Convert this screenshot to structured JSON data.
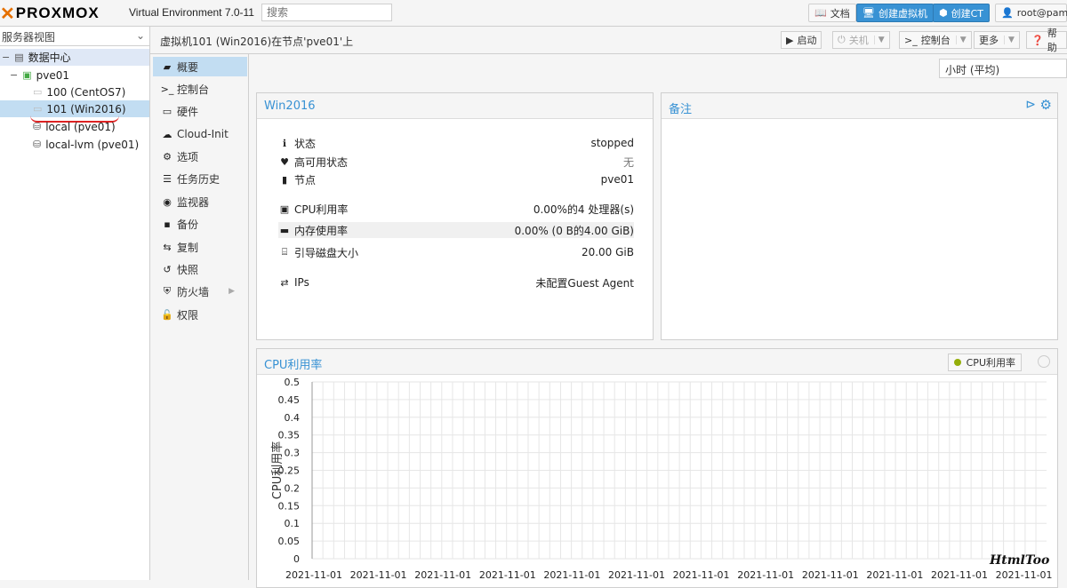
{
  "topbar": {
    "logo_text": "PROXMOX",
    "version": "Virtual Environment 7.0-11",
    "search_placeholder": "搜索",
    "docs_label": "文档",
    "create_vm_label": "创建虚拟机",
    "create_ct_label": "创建CT",
    "user_label": "root@pam"
  },
  "tree": {
    "view_label": "服务器视图",
    "datacenter": "数据中心",
    "node": "pve01",
    "vm100": "100 (CentOS7)",
    "vm101": "101 (Win2016)",
    "storage_local": "local (pve01)",
    "storage_lvm": "local-lvm (pve01)"
  },
  "header": {
    "title": "虚拟机101 (Win2016)在节点'pve01'上",
    "start": "启动",
    "shutdown": "关机",
    "console": "控制台",
    "more": "更多",
    "help": "帮助"
  },
  "nav": [
    {
      "label": "概要",
      "icon": "book-icon"
    },
    {
      "label": "控制台",
      "icon": "terminal-icon"
    },
    {
      "label": "硬件",
      "icon": "monitor-icon"
    },
    {
      "label": "Cloud-Init",
      "icon": "cloud-icon"
    },
    {
      "label": "选项",
      "icon": "gear-icon"
    },
    {
      "label": "任务历史",
      "icon": "list-icon"
    },
    {
      "label": "监视器",
      "icon": "eye-icon"
    },
    {
      "label": "备份",
      "icon": "floppy-icon"
    },
    {
      "label": "复制",
      "icon": "retweet-icon"
    },
    {
      "label": "快照",
      "icon": "history-icon"
    },
    {
      "label": "防火墙",
      "icon": "shield-icon"
    },
    {
      "label": "权限",
      "icon": "unlock-icon"
    }
  ],
  "timeframe": "小时 (平均)",
  "status_panel": {
    "title": "Win2016",
    "status_label": "状态",
    "status_value": "stopped",
    "ha_label": "高可用状态",
    "ha_value": "无",
    "node_label": "节点",
    "node_value": "pve01",
    "cpu_label": "CPU利用率",
    "cpu_value": "0.00%的4 处理器(s)",
    "mem_label": "内存使用率",
    "mem_value": "0.00% (0 B的4.00 GiB)",
    "disk_label": "引导磁盘大小",
    "disk_value": "20.00 GiB",
    "ips_label": "IPs",
    "ips_value": "未配置Guest Agent"
  },
  "notes_panel": {
    "title": "备注"
  },
  "cpu_panel": {
    "title": "CPU利用率",
    "legend": "CPU利用率"
  },
  "chart_data": {
    "type": "line",
    "ylabel": "CPU利用率",
    "ylim": [
      0,
      0.5
    ],
    "yticks": [
      "0.5",
      "0.45",
      "0.4",
      "0.35",
      "0.3",
      "0.25",
      "0.2",
      "0.15",
      "0.1",
      "0.05",
      "0"
    ],
    "xticks": [
      "2021-11-01",
      "2021-11-01",
      "2021-11-01",
      "2021-11-01",
      "2021-11-01",
      "2021-11-01",
      "2021-11-01",
      "2021-11-01",
      "2021-11-01",
      "2021-11-01",
      "2021-11-01",
      "2021-11-01"
    ],
    "series": [
      {
        "name": "CPU利用率",
        "values": []
      }
    ],
    "grid": true
  },
  "watermark": "HtmlToo"
}
